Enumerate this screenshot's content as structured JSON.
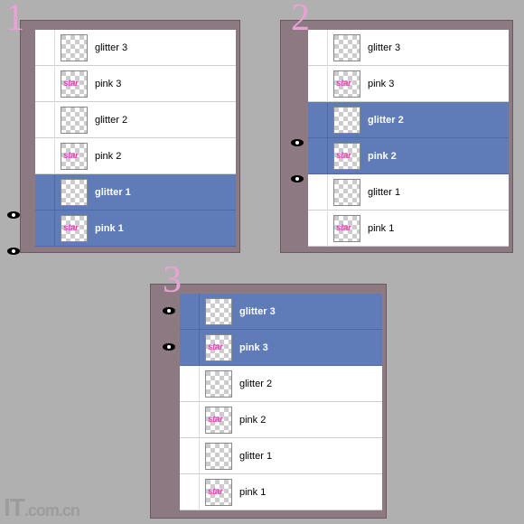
{
  "numbers": {
    "n1": "1",
    "n2": "2",
    "n3": "3"
  },
  "panel1": {
    "rows": [
      {
        "label": "glitter 3",
        "sel": false,
        "vis": false,
        "star": false
      },
      {
        "label": "pink 3",
        "sel": false,
        "vis": false,
        "star": true
      },
      {
        "label": "glitter 2",
        "sel": false,
        "vis": false,
        "star": false
      },
      {
        "label": "pink 2",
        "sel": false,
        "vis": false,
        "star": true
      },
      {
        "label": "glitter 1",
        "sel": true,
        "vis": true,
        "star": false
      },
      {
        "label": "pink 1",
        "sel": true,
        "vis": true,
        "star": true
      }
    ]
  },
  "panel2": {
    "rows": [
      {
        "label": "glitter 3",
        "sel": false,
        "vis": false,
        "star": false
      },
      {
        "label": "pink 3",
        "sel": false,
        "vis": false,
        "star": true
      },
      {
        "label": "glitter 2",
        "sel": true,
        "vis": true,
        "star": false
      },
      {
        "label": "pink 2",
        "sel": true,
        "vis": true,
        "star": true
      },
      {
        "label": "glitter 1",
        "sel": false,
        "vis": false,
        "star": false
      },
      {
        "label": "pink 1",
        "sel": false,
        "vis": false,
        "star": true
      }
    ]
  },
  "panel3": {
    "rows": [
      {
        "label": "glitter 3",
        "sel": true,
        "vis": true,
        "star": false
      },
      {
        "label": "pink 3",
        "sel": true,
        "vis": true,
        "star": true
      },
      {
        "label": "glitter 2",
        "sel": false,
        "vis": false,
        "star": false
      },
      {
        "label": "pink 2",
        "sel": false,
        "vis": false,
        "star": true
      },
      {
        "label": "glitter 1",
        "sel": false,
        "vis": false,
        "star": false
      },
      {
        "label": "pink 1",
        "sel": false,
        "vis": false,
        "star": true
      }
    ]
  },
  "watermark": "IT.com.cn"
}
